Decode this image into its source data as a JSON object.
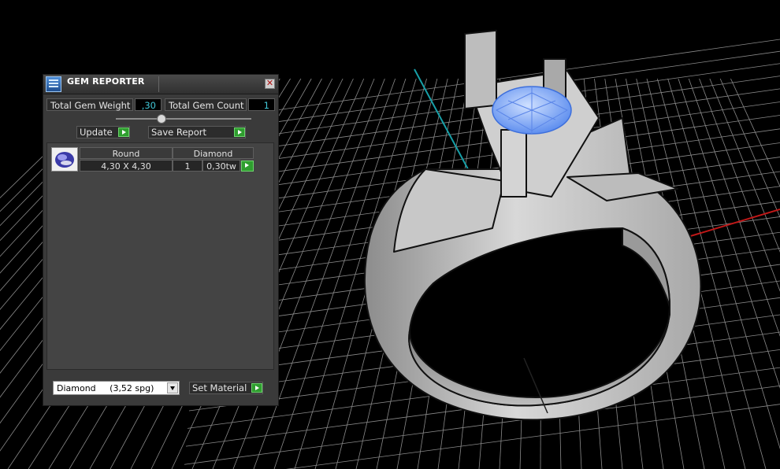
{
  "colors": {
    "viewport_bg": "#000000",
    "grid": "#8a8a8a",
    "axis_green": "#17a0a8",
    "axis_red": "#c01818",
    "gem_blue": "#8ab4ff",
    "panel_bg": "#3a3a3a",
    "value_text": "#41c8d8",
    "go_arrow": "#2f9e2f"
  },
  "panel": {
    "title": "GEM REPORTER",
    "icon": "gem-reporter-icon",
    "close_icon": "close-icon",
    "total_weight_label": "Total Gem Weight",
    "total_weight_value": ",30",
    "total_count_label": "Total Gem Count",
    "total_count_value": "1",
    "update_label": "Update",
    "save_report_label": "Save Report"
  },
  "gem_list": {
    "columns": [
      "Round",
      "Diamond"
    ],
    "rows": [
      {
        "shape": "Round",
        "size": "4,30 X 4,30",
        "material": "Diamond",
        "count": "1",
        "weight": "0,30tw",
        "thumb_icon": "round-gem-icon"
      }
    ]
  },
  "material": {
    "selected": "Diamond     (3,52 spg)",
    "set_label": "Set Material"
  },
  "viewport": {
    "object": "ring-3d-model"
  }
}
